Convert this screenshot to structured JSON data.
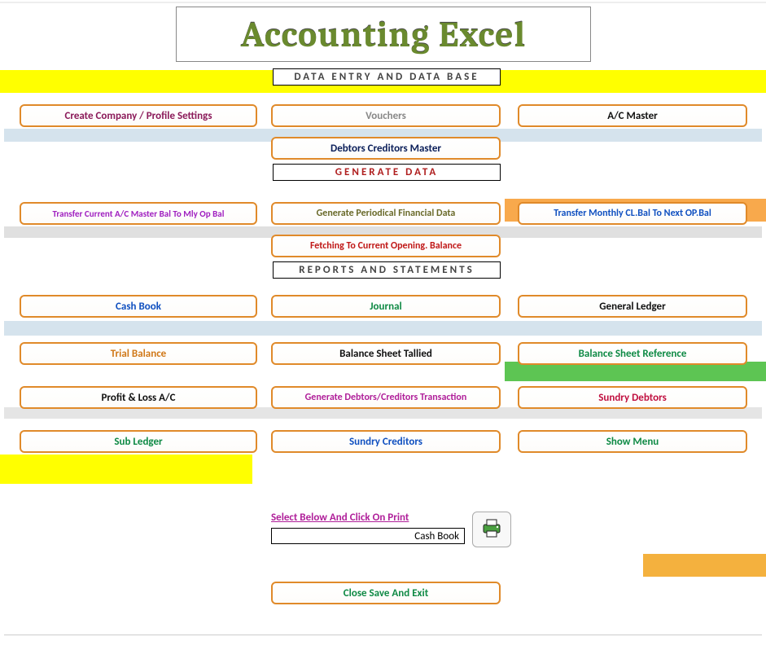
{
  "title": "Accounting Excel",
  "sections": {
    "dataentry": "DATA ENTRY  AND  DATA BASE",
    "generate": "GENERATE   DATA",
    "reports": "REPORTS  AND  STATEMENTS"
  },
  "buttons": {
    "create_company": "Create Company / Profile Settings",
    "vouchers": "Vouchers",
    "ac_master": "A/C  Master",
    "debtors_creditors_master": "Debtors Creditors Master",
    "transfer_ac_master": "Transfer Current  A/C Master  Bal  To Mly Op Bal",
    "generate_periodical": "Generate Periodical Financial Data",
    "transfer_monthly": "Transfer Monthly  CL.Bal To Next OP.Bal",
    "fetching_opening": "Fetching  To Current Opening. Balance",
    "cash_book": "Cash Book",
    "journal": "Journal",
    "general_ledger": "General Ledger",
    "trial_balance": "Trial Balance",
    "balance_sheet_tallied": "Balance Sheet Tallied",
    "balance_sheet_reference": "Balance Sheet Reference",
    "profit_loss": "Profit & Loss A/C",
    "generate_debtors_creditors": "Generate Debtors/Creditors Transaction",
    "sundry_debtors": "Sundry Debtors",
    "sub_ledger": "Sub Ledger",
    "sundry_creditors": "Sundry Creditors",
    "show_menu": "Show Menu",
    "close_save_exit": "Close Save And Exit"
  },
  "print": {
    "label": "Select Below And Click On Print",
    "value": "Cash Book"
  }
}
